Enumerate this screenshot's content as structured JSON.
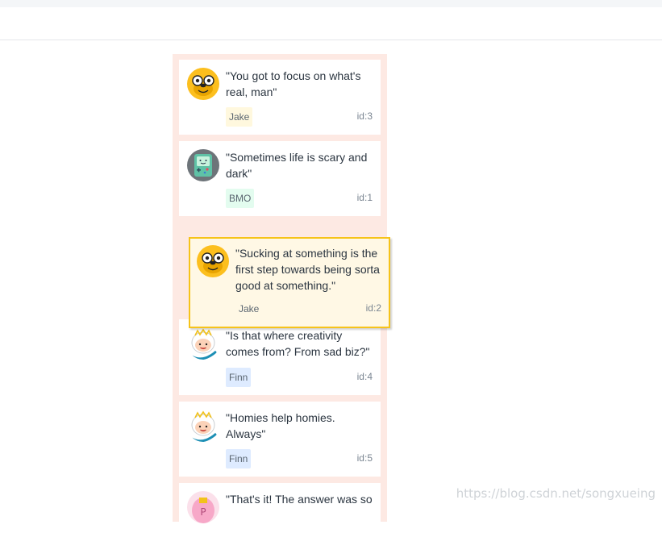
{
  "quotes": [
    {
      "text": "\"You got to focus on what's real, man\"",
      "author": "Jake",
      "id_label": "id:3"
    },
    {
      "text": "\"Sometimes life is scary and dark\"",
      "author": "BMO",
      "id_label": "id:1"
    },
    {
      "text": "\"Is that where creativity comes from? From sad biz?\"",
      "author": "Finn",
      "id_label": "id:4"
    },
    {
      "text": "\"Homies help homies. Always\"",
      "author": "Finn",
      "id_label": "id:5"
    },
    {
      "text": "\"That's it! The answer was so",
      "author": "",
      "id_label": ""
    }
  ],
  "dragging": {
    "text": "\"Sucking at something is the first step towards being sorta good at something.\"",
    "author": "Jake",
    "id_label": "id:2"
  },
  "colors": {
    "column_bg": "#fde9e3",
    "drag_border": "#f6c31a",
    "drag_bg": "#fff8e5",
    "jake_tag": "#fff8de",
    "bmo_tag": "#e3fcef",
    "finn_tag": "#deebff"
  },
  "watermark": "https://blog.csdn.net/songxueing"
}
